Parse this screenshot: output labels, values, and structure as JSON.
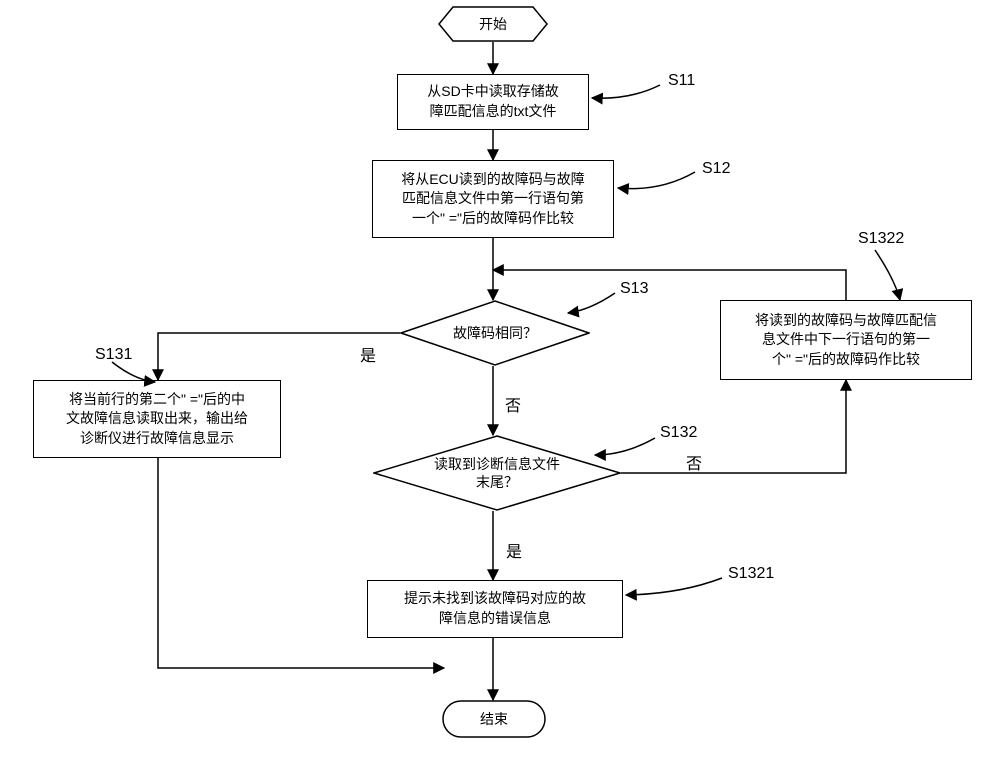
{
  "terminator": {
    "start": "开始",
    "end": "结束"
  },
  "steps": {
    "s11": "从SD卡中读取存储故\n障匹配信息的txt文件",
    "s12": "将从ECU读到的故障码与故障\n匹配信息文件中第一行语句第\n一个\" =\"后的故障码作比较",
    "s131": "将当前行的第二个\" =\"后的中\n文故障信息读取出来，输出给\n诊断仪进行故障信息显示",
    "s1322": "将读到的故障码与故障匹配信\n息文件中下一行语句的第一\n个\" =\"后的故障码作比较",
    "s1321": "提示未找到该故障码对应的故\n障信息的错误信息"
  },
  "decisions": {
    "s13": "故障码相同？",
    "s132": "读取到诊断信息文件\n末尾？"
  },
  "branch": {
    "yes": "是",
    "no": "否"
  },
  "tags": {
    "s11": "S11",
    "s12": "S12",
    "s13": "S13",
    "s131": "S131",
    "s132": "S132",
    "s1321": "S1321",
    "s1322": "S1322"
  }
}
